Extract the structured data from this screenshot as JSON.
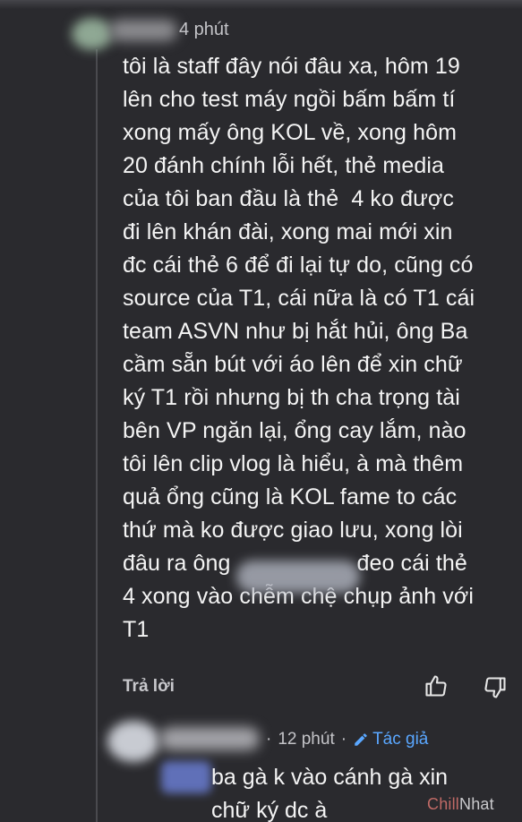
{
  "comment": {
    "time": "4 phút",
    "body": "tôi là staff đây nói đâu xa, hôm 19\nlên cho test máy ngồi bấm bấm tí\nxong mấy ông KOL về, xong hôm\n20 đánh chính lỗi hết, thẻ media\ncủa tôi ban đầu là thẻ  4 ko được\nđi lên khán đài, xong mai mới xin\nđc cái thẻ 6 để đi lại tự do, cũng có\nsource của T1, cái nữa là có T1 cái\nteam ASVN như bị hắt hủi, ông Ba\ncầm sẵn bút với áo lên để xin chữ\nký T1 rồi nhưng bị th cha trọng tài\nbên VP ngăn lại, ổng cay lắm, nào\ntôi lên clip vlog là hiểu, à mà thêm\nquả ổng cũng là KOL fame to các\nthứ mà ko được giao lưu, xong lòi\nđâu ra ông                    đeo cái thẻ\n4 xong vào chễm chệ chụp ảnh với\nT1",
    "reply_label": "Trả lời",
    "like_icon": "thumbs-up-icon",
    "dislike_icon": "thumbs-down-icon"
  },
  "reply": {
    "time": "12 phút",
    "separator": "·",
    "author_badge": "Tác giả",
    "author_icon": "pencil-icon",
    "body": "ba gà k vào cánh gà xin\nchữ ký dc à"
  },
  "watermark": {
    "part1": "Chill",
    "part2": "Nhat"
  },
  "colors": {
    "background": "#2a2a2e",
    "text": "#f4f4f4",
    "meta": "#c4c4c8",
    "author_badge": "#5aa7ff"
  }
}
